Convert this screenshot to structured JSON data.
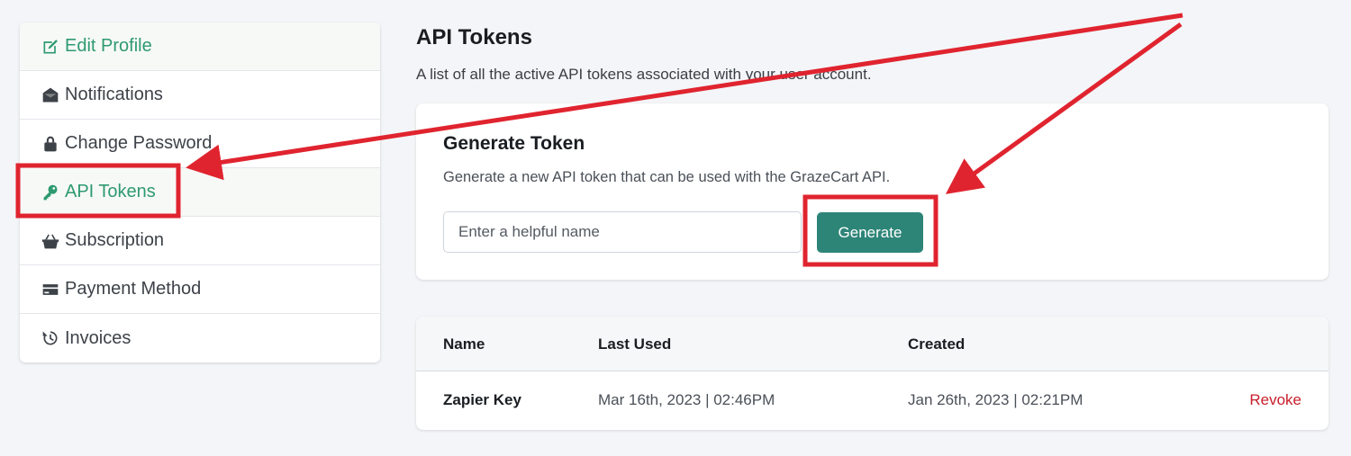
{
  "sidebar": {
    "items": [
      {
        "label": "Edit Profile",
        "icon": "edit-icon"
      },
      {
        "label": "Notifications",
        "icon": "envelope-icon"
      },
      {
        "label": "Change Password",
        "icon": "lock-icon"
      },
      {
        "label": "API Tokens",
        "icon": "key-icon"
      },
      {
        "label": "Subscription",
        "icon": "basket-icon"
      },
      {
        "label": "Payment Method",
        "icon": "credit-card-icon"
      },
      {
        "label": "Invoices",
        "icon": "history-icon"
      }
    ],
    "active_label": "API Tokens"
  },
  "main": {
    "title": "API Tokens",
    "description": "A list of all the active API tokens associated with your user account."
  },
  "generate": {
    "title": "Generate Token",
    "description": "Generate a new API token that can be used with the GrazeCart API.",
    "input_value": "",
    "input_placeholder": "Enter a helpful name",
    "button_label": "Generate"
  },
  "tokens": {
    "columns": [
      "Name",
      "Last Used",
      "Created"
    ],
    "rows": [
      {
        "name": "Zapier Key",
        "last_used": "Mar 16th, 2023 | 02:46PM",
        "created": "Jan 26th, 2023 | 02:21PM",
        "action": "Revoke"
      }
    ]
  },
  "colors": {
    "accent": "#2e9a6f",
    "button": "#2d8578",
    "danger": "#c81e2b",
    "annotation": "#e0242f"
  }
}
